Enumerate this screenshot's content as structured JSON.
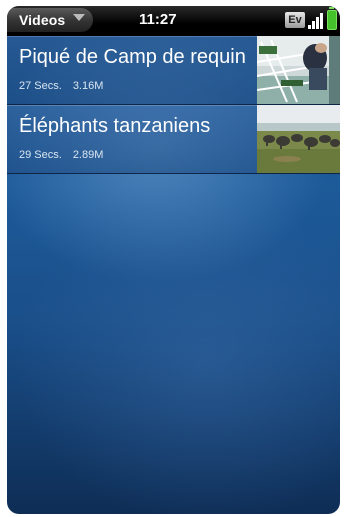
{
  "status_bar": {
    "app_menu_label": "Videos",
    "time": "11:27",
    "network_label": "Ev"
  },
  "videos": [
    {
      "title": "Piqué de Camp de requin",
      "duration": "27 Secs.",
      "size": "3.16M",
      "thumbnail": "shark-cage-thumbnail"
    },
    {
      "title": "Éléphants tanzaniens",
      "duration": "29 Secs.",
      "size": "2.89M",
      "thumbnail": "elephants-thumbnail"
    }
  ],
  "colors": {
    "background_top": "#0b3c73",
    "background_mid": "#1d5a99",
    "battery": "#45c12c"
  }
}
